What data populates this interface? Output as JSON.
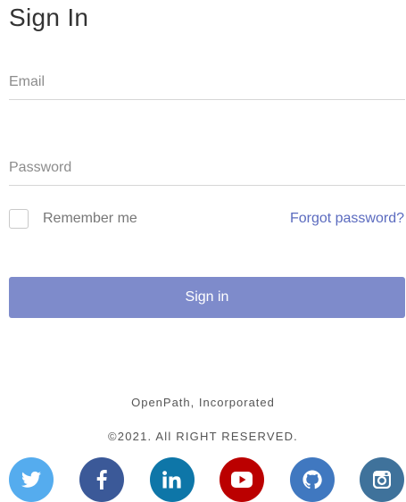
{
  "page": {
    "title": "Sign In"
  },
  "form": {
    "email_placeholder": "Email",
    "password_placeholder": "Password",
    "remember_label": "Remember me",
    "remember_checked": false,
    "forgot_label": "Forgot password?",
    "submit_label": "Sign in"
  },
  "footer": {
    "company": "OpenPath, Incorporated",
    "copyright": "©2021. All RIGHT RESERVED."
  },
  "social": [
    {
      "name": "twitter",
      "icon": "twitter-icon",
      "color": "#55acee"
    },
    {
      "name": "facebook",
      "icon": "facebook-icon",
      "color": "#3b5998"
    },
    {
      "name": "linkedin",
      "icon": "linkedin-icon",
      "color": "#0e76a8"
    },
    {
      "name": "youtube",
      "icon": "youtube-icon",
      "color": "#bb0000"
    },
    {
      "name": "github",
      "icon": "github-icon",
      "color": "#4078c0"
    },
    {
      "name": "instagram",
      "icon": "instagram-icon",
      "color": "#3f729b"
    }
  ],
  "colors": {
    "accent_button": "#7e8bcb",
    "link": "#5b6bbf"
  }
}
